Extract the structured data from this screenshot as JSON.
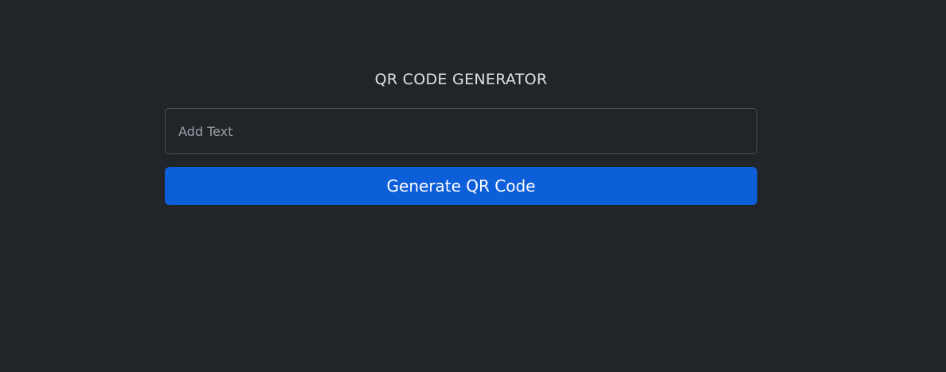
{
  "header": {
    "title": "QR CODE GENERATOR"
  },
  "form": {
    "input_value": "",
    "input_placeholder": "Add Text",
    "generate_label": "Generate QR Code"
  },
  "colors": {
    "background": "#212429",
    "button": "#0d5ed9",
    "title_text": "#dee2e6",
    "input_border": "#4a4e55",
    "placeholder_text": "#9aa0a6"
  }
}
